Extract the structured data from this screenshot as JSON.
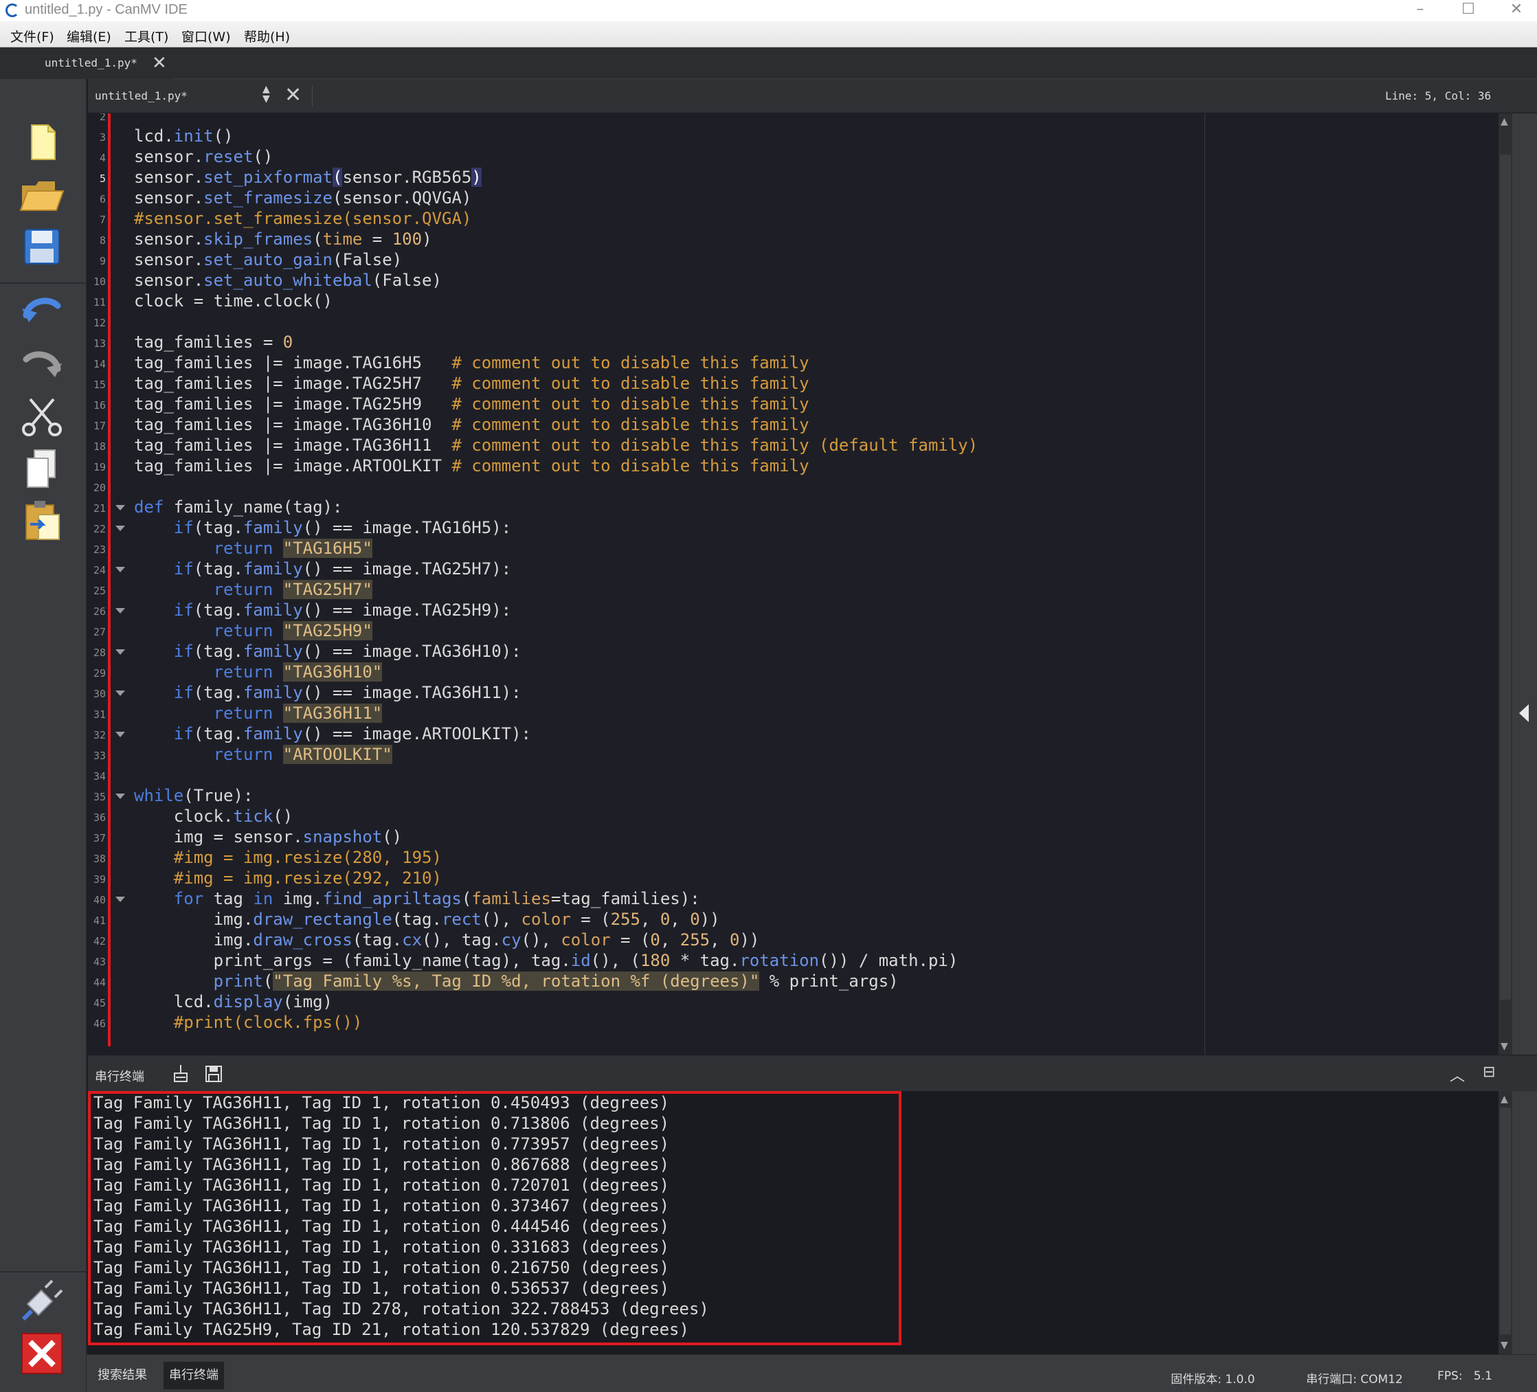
{
  "window": {
    "title": "untitled_1.py - CanMV IDE",
    "minimize": "–",
    "maximize": "☐",
    "close": "✕"
  },
  "menu": [
    "文件(F)",
    "编辑(E)",
    "工具(T)",
    "窗口(W)",
    "帮助(H)"
  ],
  "file_tab": {
    "label": "untitled_1.py*",
    "close": "✕"
  },
  "toolbar": {
    "items": [
      "new-file",
      "open-file",
      "save-file",
      "undo",
      "redo",
      "cut",
      "copy",
      "paste",
      "connect",
      "stop"
    ]
  },
  "editor_header": {
    "file_combo": "untitled_1.py*",
    "combo_arrows": "▲▼",
    "close": "✕",
    "line_col": "Line: 5, Col: 36"
  },
  "editor": {
    "current_line": 5,
    "lines": [
      {
        "n": "2",
        "text": ""
      },
      {
        "n": "3",
        "text": "lcd.init()"
      },
      {
        "n": "4",
        "text": "sensor.reset()"
      },
      {
        "n": "5",
        "text": "sensor.set_pixformat(sensor.RGB565)"
      },
      {
        "n": "6",
        "text": "sensor.set_framesize(sensor.QQVGA)"
      },
      {
        "n": "7",
        "text": "#sensor.set_framesize(sensor.QVGA)"
      },
      {
        "n": "8",
        "text": "sensor.skip_frames(time = 100)"
      },
      {
        "n": "9",
        "text": "sensor.set_auto_gain(False)"
      },
      {
        "n": "10",
        "text": "sensor.set_auto_whitebal(False)"
      },
      {
        "n": "11",
        "text": "clock = time.clock()"
      },
      {
        "n": "12",
        "text": ""
      },
      {
        "n": "13",
        "text": "tag_families = 0"
      },
      {
        "n": "14",
        "text": "tag_families |= image.TAG16H5   # comment out to disable this family"
      },
      {
        "n": "15",
        "text": "tag_families |= image.TAG25H7   # comment out to disable this family"
      },
      {
        "n": "16",
        "text": "tag_families |= image.TAG25H9   # comment out to disable this family"
      },
      {
        "n": "17",
        "text": "tag_families |= image.TAG36H10  # comment out to disable this family"
      },
      {
        "n": "18",
        "text": "tag_families |= image.TAG36H11  # comment out to disable this family (default family)"
      },
      {
        "n": "19",
        "text": "tag_families |= image.ARTOOLKIT # comment out to disable this family"
      },
      {
        "n": "20",
        "text": ""
      },
      {
        "n": "21",
        "text": "def family_name(tag):"
      },
      {
        "n": "22",
        "text": "    if(tag.family() == image.TAG16H5):"
      },
      {
        "n": "23",
        "text": "        return \"TAG16H5\""
      },
      {
        "n": "24",
        "text": "    if(tag.family() == image.TAG25H7):"
      },
      {
        "n": "25",
        "text": "        return \"TAG25H7\""
      },
      {
        "n": "26",
        "text": "    if(tag.family() == image.TAG25H9):"
      },
      {
        "n": "27",
        "text": "        return \"TAG25H9\""
      },
      {
        "n": "28",
        "text": "    if(tag.family() == image.TAG36H10):"
      },
      {
        "n": "29",
        "text": "        return \"TAG36H10\""
      },
      {
        "n": "30",
        "text": "    if(tag.family() == image.TAG36H11):"
      },
      {
        "n": "31",
        "text": "        return \"TAG36H11\""
      },
      {
        "n": "32",
        "text": "    if(tag.family() == image.ARTOOLKIT):"
      },
      {
        "n": "33",
        "text": "        return \"ARTOOLKIT\""
      },
      {
        "n": "34",
        "text": ""
      },
      {
        "n": "35",
        "text": "while(True):"
      },
      {
        "n": "36",
        "text": "    clock.tick()"
      },
      {
        "n": "37",
        "text": "    img = sensor.snapshot()"
      },
      {
        "n": "38",
        "text": "    #img = img.resize(280, 195)"
      },
      {
        "n": "39",
        "text": "    #img = img.resize(292, 210)"
      },
      {
        "n": "40",
        "text": "    for tag in img.find_apriltags(families=tag_families):"
      },
      {
        "n": "41",
        "text": "        img.draw_rectangle(tag.rect(), color = (255, 0, 0))"
      },
      {
        "n": "42",
        "text": "        img.draw_cross(tag.cx(), tag.cy(), color = (0, 255, 0))"
      },
      {
        "n": "43",
        "text": "        print_args = (family_name(tag), tag.id(), (180 * tag.rotation()) / math.pi)"
      },
      {
        "n": "44",
        "text": "        print(\"Tag Family %s, Tag ID %d, rotation %f (degrees)\" % print_args)"
      },
      {
        "n": "45",
        "text": "    lcd.display(img)"
      },
      {
        "n": "46",
        "text": "    #print(clock.fps())"
      }
    ],
    "fold_lines": [
      "21",
      "22",
      "24",
      "26",
      "28",
      "30",
      "32",
      "35",
      "40"
    ]
  },
  "terminal": {
    "title": "串行终端",
    "lines": [
      "Tag Family TAG36H11, Tag ID 1, rotation 0.450493 (degrees)",
      "Tag Family TAG36H11, Tag ID 1, rotation 0.713806 (degrees)",
      "Tag Family TAG36H11, Tag ID 1, rotation 0.773957 (degrees)",
      "Tag Family TAG36H11, Tag ID 1, rotation 0.867688 (degrees)",
      "Tag Family TAG36H11, Tag ID 1, rotation 0.720701 (degrees)",
      "Tag Family TAG36H11, Tag ID 1, rotation 0.373467 (degrees)",
      "Tag Family TAG36H11, Tag ID 1, rotation 0.444546 (degrees)",
      "Tag Family TAG36H11, Tag ID 1, rotation 0.331683 (degrees)",
      "Tag Family TAG36H11, Tag ID 1, rotation 0.216750 (degrees)",
      "Tag Family TAG36H11, Tag ID 1, rotation 0.536537 (degrees)",
      "Tag Family TAG36H11, Tag ID 278, rotation 322.788453 (degrees)",
      "Tag Family TAG25H9, Tag ID 21, rotation 120.537829 (degrees)"
    ]
  },
  "statusbar": {
    "tabs": [
      "搜索结果",
      "串行终端"
    ],
    "active_tab": 1,
    "firmware": "固件版本: 1.0.0",
    "serial_port": "串行端口: COM12",
    "fps": "FPS:   5.1"
  },
  "colors": {
    "highlight_red": "#e0191e",
    "editor_bg": "#1e1f26",
    "keyword_blue": "#4f7ee0",
    "comment_orange": "#d59a3c"
  }
}
